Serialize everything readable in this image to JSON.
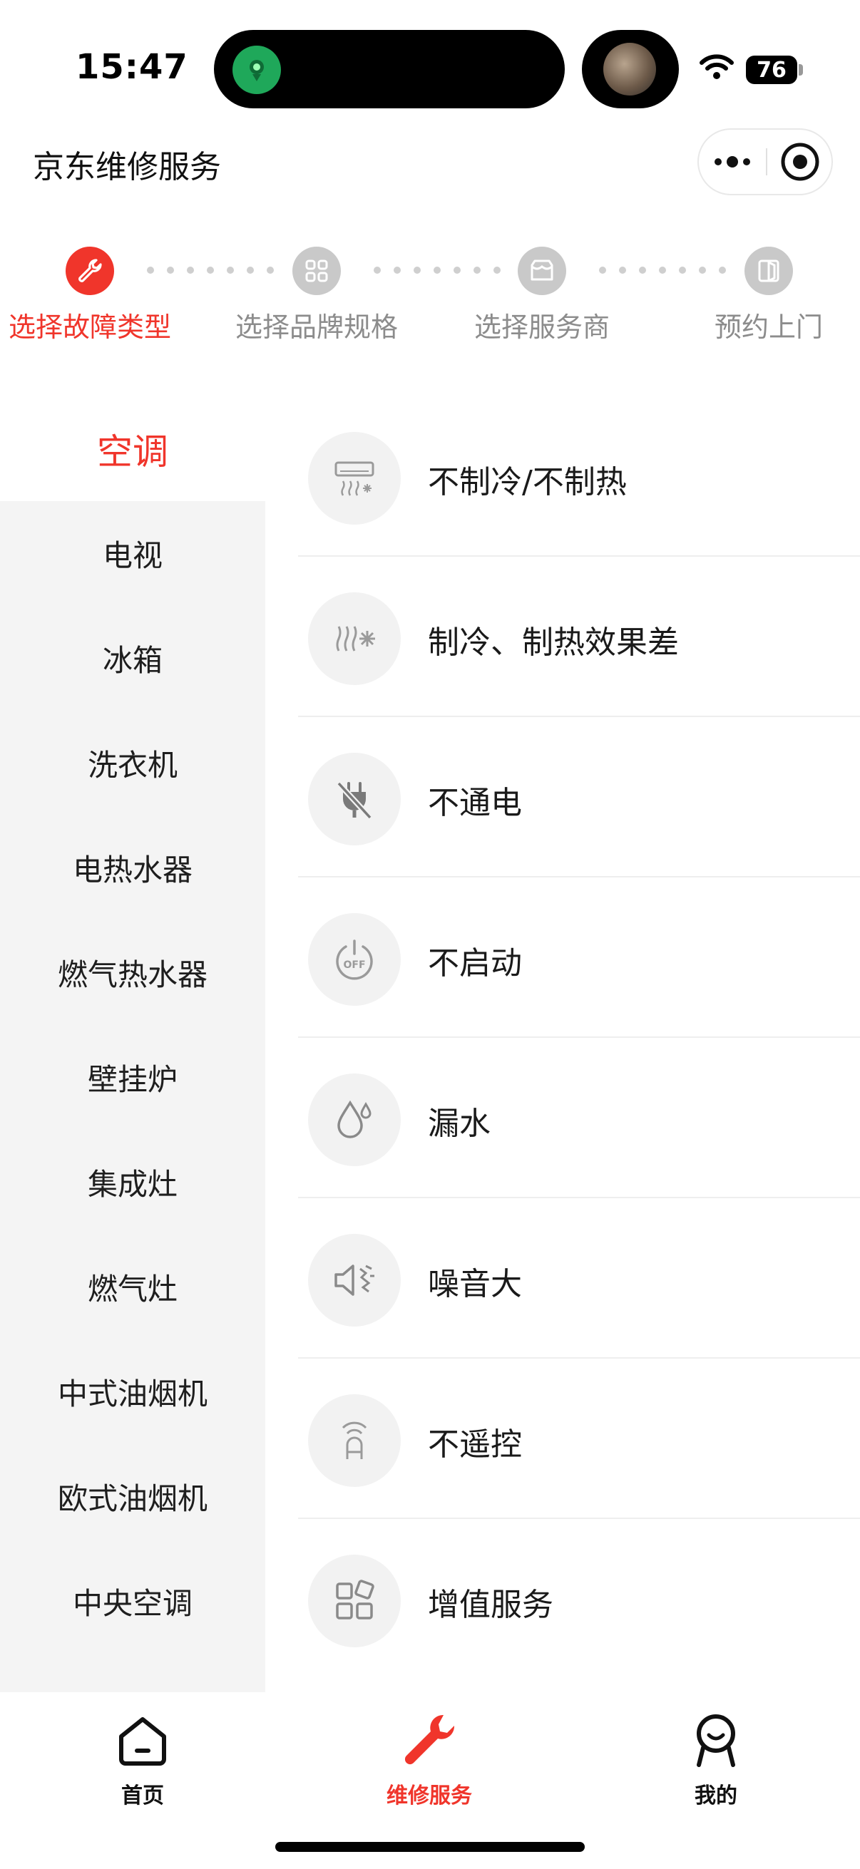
{
  "status_bar": {
    "time": "15:47",
    "battery": "76"
  },
  "header": {
    "title": "京东维修服务"
  },
  "stepper": {
    "steps": [
      {
        "label": "选择故障类型",
        "icon": "wrench-icon",
        "active": true
      },
      {
        "label": "选择品牌规格",
        "icon": "grid-icon",
        "active": false
      },
      {
        "label": "选择服务商",
        "icon": "store-icon",
        "active": false
      },
      {
        "label": "预约上门",
        "icon": "door-icon",
        "active": false
      }
    ]
  },
  "categories": [
    {
      "label": "空调",
      "active": true
    },
    {
      "label": "电视"
    },
    {
      "label": "冰箱"
    },
    {
      "label": "洗衣机"
    },
    {
      "label": "电热水器"
    },
    {
      "label": "燃气热水器"
    },
    {
      "label": "壁挂炉"
    },
    {
      "label": "集成灶"
    },
    {
      "label": "燃气灶"
    },
    {
      "label": "中式油烟机"
    },
    {
      "label": "欧式油烟机"
    },
    {
      "label": "中央空调"
    }
  ],
  "faults": [
    {
      "label": "不制冷/不制热",
      "icon": "ac-unit-icon"
    },
    {
      "label": "制冷、制热效果差",
      "icon": "heat-cold-icon"
    },
    {
      "label": "不通电",
      "icon": "no-power-plug-icon"
    },
    {
      "label": "不启动",
      "icon": "power-off-icon"
    },
    {
      "label": "漏水",
      "icon": "water-drop-icon"
    },
    {
      "label": "噪音大",
      "icon": "speaker-noise-icon"
    },
    {
      "label": "不遥控",
      "icon": "remote-control-icon"
    },
    {
      "label": "增值服务",
      "icon": "apps-icon"
    }
  ],
  "tab_bar": {
    "tabs": [
      {
        "label": "首页",
        "icon": "home-icon",
        "active": false
      },
      {
        "label": "维修服务",
        "icon": "wrench-icon",
        "active": true
      },
      {
        "label": "我的",
        "icon": "profile-icon",
        "active": false
      }
    ]
  },
  "colors": {
    "accent": "#f0352b",
    "sidebar_bg": "#f4f4f4",
    "inactive_text": "#8c8c8c"
  }
}
